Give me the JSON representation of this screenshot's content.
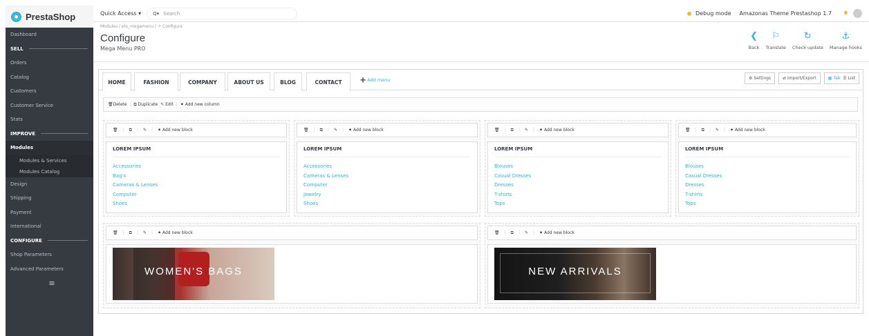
{
  "app": {
    "name": "PrestaShop"
  },
  "topbar": {
    "quick_access": "Quick Access ▾",
    "search_placeholder": "Search",
    "debug": "Debug mode",
    "theme": "Amazonas Theme Prestashop 1.7"
  },
  "sidebar": {
    "items": [
      {
        "label": "Dashboard",
        "type": "item"
      },
      {
        "label": "SELL",
        "type": "section"
      },
      {
        "label": "Orders",
        "type": "item"
      },
      {
        "label": "Catalog",
        "type": "item"
      },
      {
        "label": "Customers",
        "type": "item"
      },
      {
        "label": "Customer Service",
        "type": "item"
      },
      {
        "label": "Stats",
        "type": "item"
      },
      {
        "label": "IMPROVE",
        "type": "section"
      },
      {
        "label": "Modules",
        "type": "active"
      },
      {
        "label": "Modules & Services",
        "type": "sub"
      },
      {
        "label": "Modules Catalog",
        "type": "sub"
      },
      {
        "label": "Design",
        "type": "item"
      },
      {
        "label": "Shipping",
        "type": "item"
      },
      {
        "label": "Payment",
        "type": "item"
      },
      {
        "label": "International",
        "type": "item"
      },
      {
        "label": "CONFIGURE",
        "type": "section"
      },
      {
        "label": "Shop Parameters",
        "type": "item"
      },
      {
        "label": "Advanced Parameters",
        "type": "item"
      },
      {
        "label": "≡",
        "type": "burger"
      }
    ]
  },
  "page": {
    "breadcrumb": "Modules  /  ets_megamenu  /  ↗ Configure",
    "title": "Configure",
    "subtitle": "Mega Menu PRO"
  },
  "toolbar": {
    "buttons": [
      {
        "label": "Back",
        "icon": "back-icon",
        "glyph": "❮"
      },
      {
        "label": "Translate",
        "icon": "flag-icon",
        "glyph": "⚐"
      },
      {
        "label": "Check update",
        "icon": "refresh-icon",
        "glyph": "↻"
      },
      {
        "label": "Manage hooks",
        "icon": "anchor-icon",
        "glyph": "⚓"
      }
    ]
  },
  "menu": {
    "tabs": [
      "HOME",
      "FASHION",
      "COMPANY",
      "ABOUT US",
      "BLOG",
      "CONTACT"
    ],
    "active_tab": "FASHION",
    "add_menu": "Add menu",
    "settings": "Settings",
    "import_export": "Import/Export",
    "tab_view": "Tab",
    "list_view": "List"
  },
  "column_bar": {
    "delete": "Delete",
    "duplicate": "Duplicate",
    "edit": "Edit",
    "add_column": "Add new column"
  },
  "add_block": "Add new block",
  "columns": [
    {
      "heading": "LOREM IPSUM",
      "links": [
        "Accessories",
        "Bag's",
        "Cameras & Lenses",
        "Computer",
        "Shoes"
      ]
    },
    {
      "heading": "LOREM IPSUM",
      "links": [
        "Accessories",
        "Cameras & Lenses",
        "Computer",
        "Jewelry",
        "Shoes"
      ]
    },
    {
      "heading": "LOREM IPSUM",
      "links": [
        "Blouses",
        "Casual Dresses",
        "Dresses",
        "T-shirts",
        "Tops"
      ]
    },
    {
      "heading": "LOREM IPSUM",
      "links": [
        "Blouses",
        "Casual Dresses",
        "Dresses",
        "T-shirts",
        "Tops"
      ]
    }
  ],
  "banners": [
    {
      "text": "WOMEN'S BAGS"
    },
    {
      "text": "NEW ARRIVALS"
    }
  ],
  "colors": {
    "accent": "#25b9d7",
    "sidebar": "#363a41",
    "warning": "#fbbb22"
  }
}
